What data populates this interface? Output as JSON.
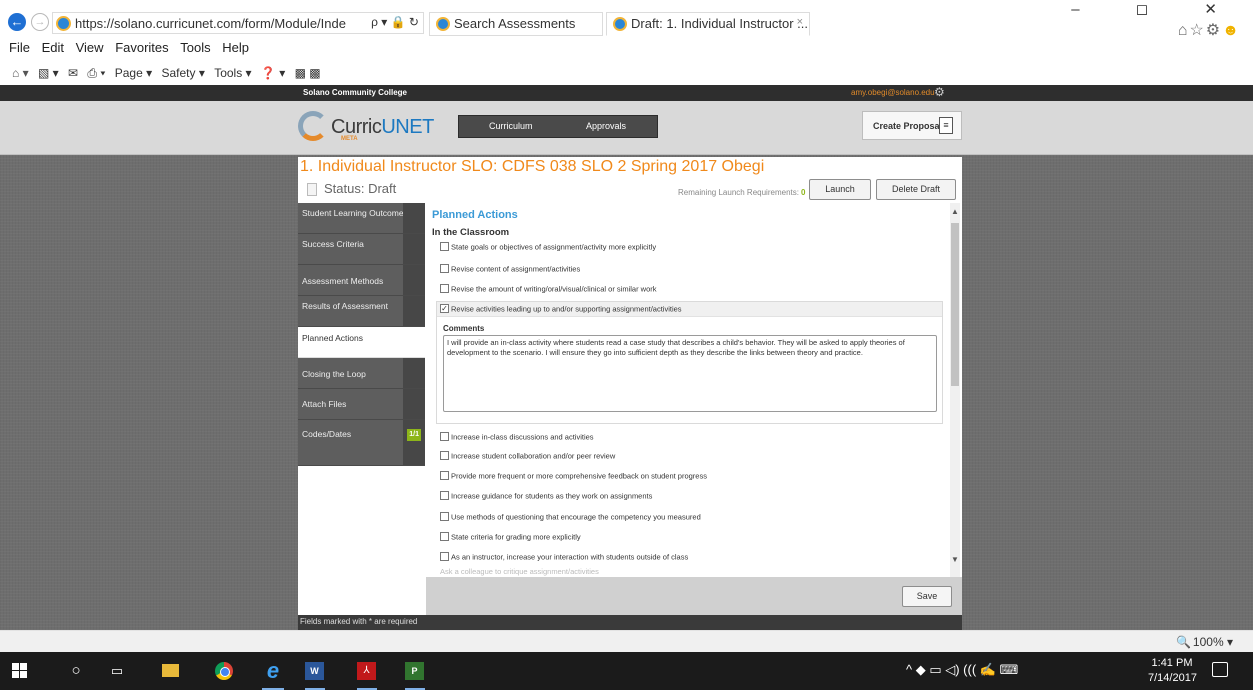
{
  "browser": {
    "url": "https://solano.curricunet.com/form/Module/Inde",
    "address_icons": "ρ ▾ 🔒 ↻",
    "tabs": [
      {
        "label": "Search Assessments"
      },
      {
        "label": "Draft: 1. Individual Instructor ..."
      }
    ],
    "tab_close": "×",
    "window_controls": "– ◻ ✕",
    "toolbar_icons": "⌂☆⚙",
    "smiley": "☻",
    "menu": [
      "File",
      "Edit",
      "View",
      "Favorites",
      "Tools",
      "Help"
    ],
    "command_bar": [
      "Page ▾",
      "Safety ▾",
      "Tools ▾"
    ],
    "zoom": "100%",
    "zoom_dropdown": "▾"
  },
  "site": {
    "college": "Solano Community College",
    "user_email": "amy.obegi@solano.edu",
    "logo_prefix": "Curric",
    "logo_accent": "UNET",
    "logo_sub": "META",
    "nav": [
      "Curriculum",
      "Approvals"
    ],
    "create_proposal": "Create Proposal",
    "colors": {
      "title_orange": "#f0891b",
      "heading_blue": "#3b9ad6",
      "badge_green": "#8db51a"
    }
  },
  "record": {
    "title": "1. Individual Instructor SLO: CDFS 038 SLO 2 Spring 2017 Obegi",
    "status": "Status: Draft",
    "remaining_label": "Remaining Launch Requirements:",
    "remaining_count": "0",
    "launch_label": "Launch",
    "delete_label": "Delete Draft"
  },
  "sections": [
    {
      "label": "Student Learning Outcome"
    },
    {
      "label": "Success Criteria"
    },
    {
      "label": "Assessment Methods"
    },
    {
      "label": "Results of Assessment"
    },
    {
      "label": "Planned Actions",
      "active": true
    },
    {
      "label": "Closing the Loop"
    },
    {
      "label": "Attach Files"
    },
    {
      "label": "Codes/Dates",
      "badge": "1/1"
    }
  ],
  "form": {
    "heading": "Planned Actions",
    "subheading": "In the Classroom",
    "options_before": [
      "State goals or objectives of assignment/activity more explicitly",
      "Revise content of assignment/activities",
      "Revise the amount of writing/oral/visual/clinical or similar work"
    ],
    "checked_option": "Revise activities leading up to and/or supporting assignment/activities",
    "checked_mark": "✓",
    "comments_label": "Comments",
    "comments_text": "I will provide an in-class activity where students read a case study that describes a child's behavior. They will be asked to apply theories of development to the scenario. I will ensure they go into sufficient depth as they describe the links between theory and practice.",
    "options_after": [
      "Increase in-class discussions and activities",
      "Increase student collaboration and/or peer review",
      "Provide more frequent or more comprehensive feedback on student progress",
      "Increase guidance for students as they work on assignments",
      "Use methods of questioning that encourage the competency you measured",
      "State criteria for grading more explicitly",
      "As an instructor, increase your interaction with students outside of class"
    ],
    "faded_option": "Ask a colleague to critique assignment/activities",
    "save_label": "Save",
    "required_note": "Fields marked with * are required"
  },
  "taskbar": {
    "time": "1:41 PM",
    "date": "7/14/2017",
    "tray": "^ ◆ ▭ ◁) ((( ✍ ⌨"
  }
}
